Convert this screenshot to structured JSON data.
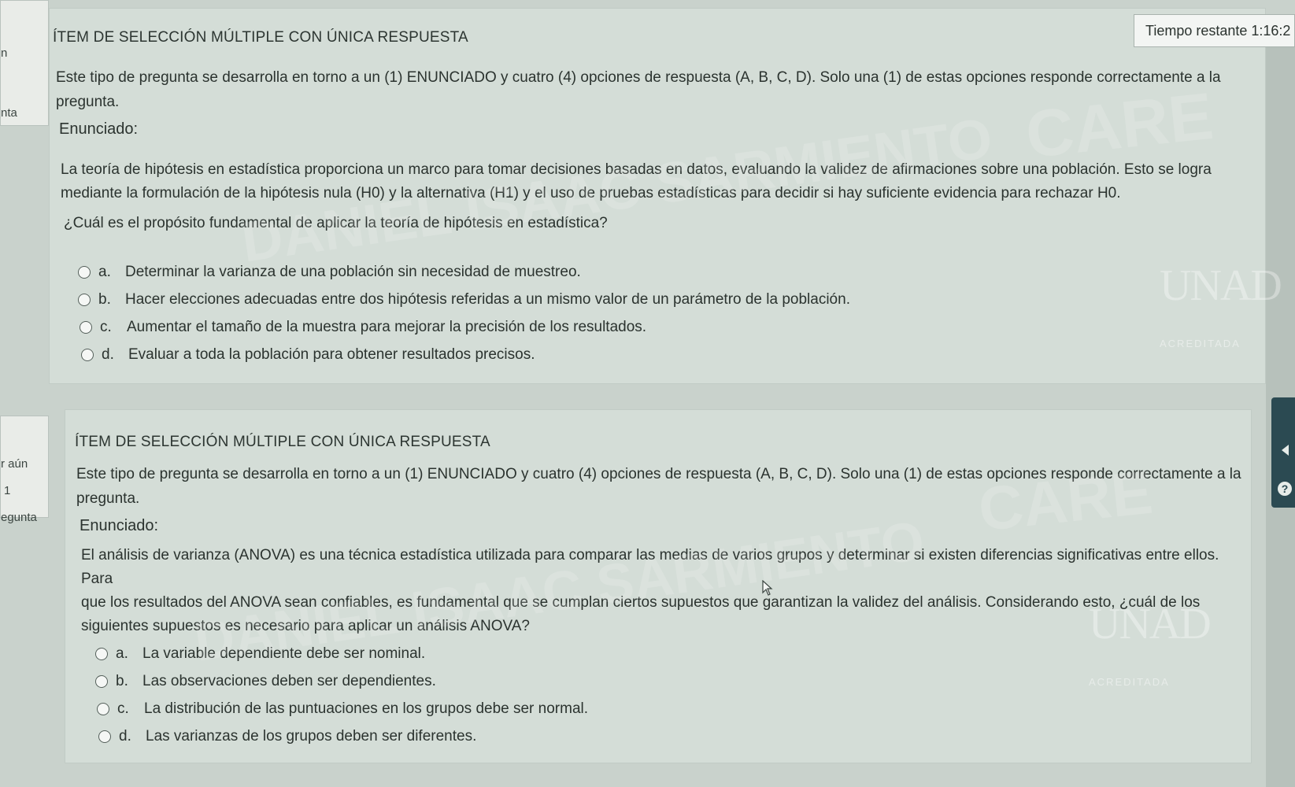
{
  "timer": {
    "label": "Tiempo restante 1:16:2"
  },
  "left_nav": {
    "top_fragments": [
      "n",
      "nta"
    ],
    "bottom_fragments": [
      "r aún",
      "1",
      "egunta"
    ]
  },
  "questions": [
    {
      "type_header": "ÍTEM DE SELECCIÓN MÚLTIPLE CON ÚNICA RESPUESTA",
      "instructions_line1": "Este tipo de pregunta se desarrolla en torno a un (1) ENUNCIADO y cuatro (4) opciones de respuesta (A, B, C, D). Solo una (1) de estas opciones responde correctamente a la",
      "instructions_line2": "pregunta.",
      "enunciado_label": "Enunciado:",
      "stem_line1": "La teoría de hipótesis en estadística proporciona un marco para tomar decisiones basadas en datos, evaluando la validez de afirmaciones sobre una población. Esto se logra",
      "stem_line2": "mediante la formulación de la hipótesis nula (H0) y la alternativa (H1) y el uso de pruebas estadísticas para decidir si hay suficiente evidencia para rechazar H0.",
      "question_text": "¿Cuál es el propósito fundamental de aplicar la teoría de hipótesis en estadística?",
      "options": [
        {
          "letter": "a.",
          "text": "Determinar la varianza de una población sin necesidad de muestreo."
        },
        {
          "letter": "b.",
          "text": "Hacer elecciones adecuadas entre dos hipótesis referidas a un mismo valor de un parámetro de la población."
        },
        {
          "letter": "c.",
          "text": "Aumentar el tamaño de la muestra para mejorar la precisión de los resultados."
        },
        {
          "letter": "d.",
          "text": "Evaluar a toda la población para obtener resultados precisos."
        }
      ]
    },
    {
      "type_header": "ÍTEM DE SELECCIÓN MÚLTIPLE CON ÚNICA RESPUESTA",
      "instructions_line1": "Este tipo de pregunta se desarrolla en torno a un (1) ENUNCIADO y cuatro (4) opciones de respuesta (A, B, C, D). Solo una (1) de estas opciones responde correctamente a la",
      "instructions_line2": "pregunta.",
      "enunciado_label": "Enunciado:",
      "stem_line1": "El análisis de varianza (ANOVA) es una técnica estadística utilizada para comparar las medias de varios grupos y determinar si existen diferencias significativas entre ellos. Para",
      "stem_line2": "que los resultados del ANOVA sean confiables, es fundamental que se cumplan ciertos supuestos que garantizan la validez del análisis. Considerando esto, ¿cuál de los",
      "question_text": "siguientes supuestos es necesario para aplicar un análisis ANOVA?",
      "options": [
        {
          "letter": "a.",
          "text": "La variable dependiente debe ser nominal."
        },
        {
          "letter": "b.",
          "text": "Las observaciones deben ser dependientes."
        },
        {
          "letter": "c.",
          "text": "La distribución de las puntuaciones en los grupos debe ser normal."
        },
        {
          "letter": "d.",
          "text": "Las varianzas de los grupos deben ser diferentes."
        }
      ]
    }
  ],
  "watermark": {
    "brand_text": "CARE",
    "name_text": "DANIEL ISAAC SARMIENTO",
    "logo_text": "UNAD",
    "accreditation_text": "ACREDITADA"
  },
  "side_panel": {
    "help_symbol": "?"
  },
  "colors": {
    "page_background": "#c9d2cc",
    "card_background": "#d4ddd7",
    "side_tab": "#2b4a52",
    "text": "#2b332f"
  }
}
